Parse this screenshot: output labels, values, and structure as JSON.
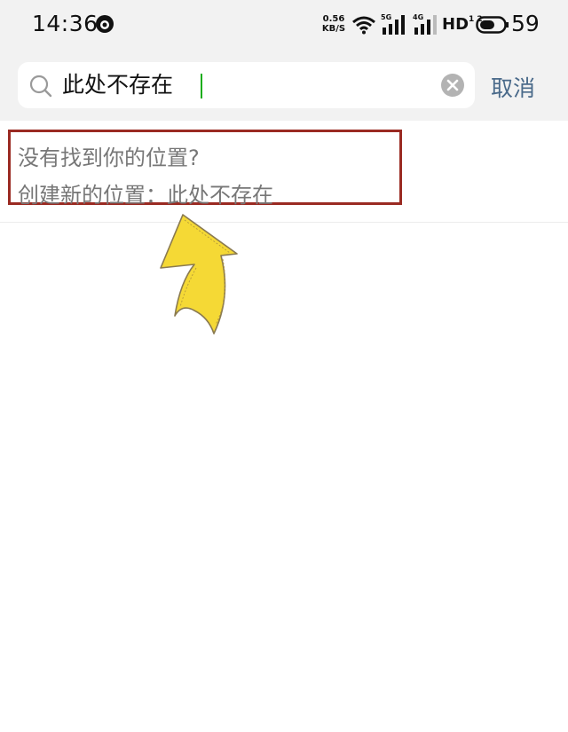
{
  "status_bar": {
    "time": "14:36",
    "net_speed_value": "0.56",
    "net_speed_unit": "KB/S",
    "signal_5g": "5G",
    "signal_4g": "4G",
    "hd": "HD",
    "hd_sub": "1 2",
    "battery_level": "59",
    "icons": [
      "app-notification-icon",
      "wifi-icon",
      "signal-icon",
      "battery-icon"
    ]
  },
  "search": {
    "query": "此处不存在",
    "cancel_label": "取消",
    "icons": [
      "search-icon",
      "clear-icon"
    ]
  },
  "result": {
    "line1": "没有找到你的位置?",
    "line2": "创建新的位置：此处不存在"
  },
  "colors": {
    "highlight_border": "#9a2a22",
    "arrow_fill": "#f5d935",
    "cancel_text": "#4a6a8a"
  }
}
